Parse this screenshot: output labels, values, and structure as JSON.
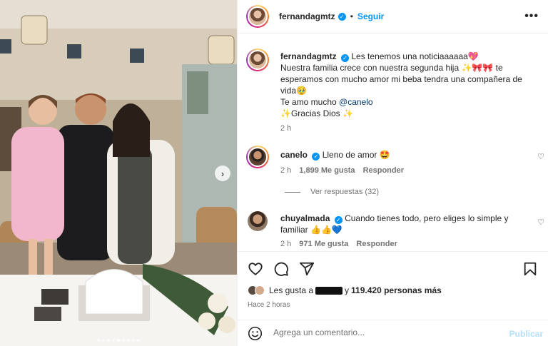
{
  "post": {
    "author": "fernandagmtz",
    "follow_label": "Seguir",
    "more_label": "•••",
    "image_count": 9,
    "active_image_index": 4
  },
  "caption": {
    "author": "fernandagmtz",
    "line1": "Les tenemos una noticiaaaaaa💖",
    "line2": "Nuestra familia crece con nuestra segunda hija ✨🎀🎀 te esperamos con mucho amor mi beba tendra una compañera de vida🥹",
    "line3_prefix": "Te amo mucho ",
    "line3_mention": "@canelo",
    "line4": "✨Gracias Dios ✨",
    "time": "2 h"
  },
  "comments": [
    {
      "author": "canelo",
      "text": "Lleno de amor 🤩",
      "time": "2 h",
      "likes": "1,899 Me gusta",
      "reply_label": "Responder",
      "view_replies": "Ver respuestas (32)"
    },
    {
      "author": "chuyalmada",
      "text": "Cuando tienes todo, pero eliges lo simple y familiar 👍👍💙",
      "time": "2 h",
      "likes": "971 Me gusta",
      "reply_label": "Responder"
    }
  ],
  "likes": {
    "prefix": "Les gusta a",
    "suffix": "y",
    "count": "119.420 personas más"
  },
  "timestamp": "Hace 2 horas",
  "comment_box": {
    "placeholder": "Agrega un comentario...",
    "publish_label": "Publicar"
  },
  "icons": {
    "like": "heart-icon",
    "comment": "comment-icon",
    "share": "send-icon",
    "save": "bookmark-icon",
    "emoji": "emoji-icon",
    "next": "chevron-right-icon"
  },
  "colors": {
    "link": "#0095f6",
    "mention": "#00376b",
    "muted": "#737373",
    "publish_disabled": "#b2dffc"
  }
}
